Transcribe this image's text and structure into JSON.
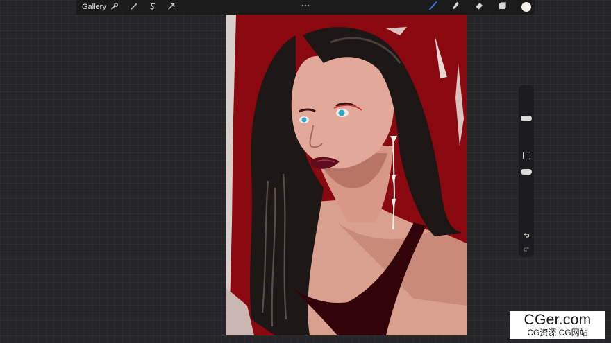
{
  "toolbar": {
    "gallery_label": "Gallery",
    "left_tools": [
      "wrench-icon",
      "magic-wand-icon",
      "selection-icon",
      "transform-arrow-icon"
    ],
    "right_tools": [
      "brush-icon",
      "smudge-icon",
      "eraser-icon",
      "layers-icon"
    ],
    "active_tool": "brush-icon",
    "active_color": "#f4f1ec",
    "accent_color": "#2e7cf6"
  },
  "canvas": {
    "subject": "digital-painting-portrait",
    "background_color": "#8a0810"
  },
  "sidebar": {
    "controls": [
      "brush-size-slider",
      "modify-button",
      "opacity-slider",
      "undo-icon",
      "redo-icon"
    ]
  },
  "watermark": {
    "main": "CGer.com",
    "sub": "CG资源 CG网站"
  }
}
